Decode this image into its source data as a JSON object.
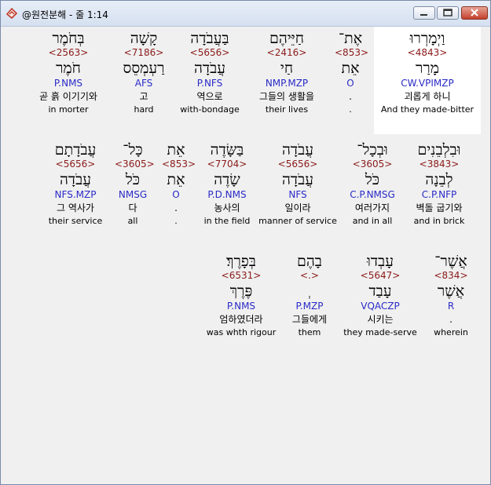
{
  "window": {
    "title": "@원전분해 - 줄 1:14"
  },
  "icons": {
    "app": "bible-app-icon",
    "minimize": "minimize-icon",
    "maximize": "maximize-icon",
    "close": "close-icon"
  },
  "rows": [
    {
      "words": [
        {
          "heb": "וַיְמָרְרוּ",
          "strong": "<4843>",
          "lemma": "מָרַר",
          "morph": "CW.VPIMZP",
          "kor": "괴롭게 하니",
          "eng": "And they made-bitter"
        },
        {
          "heb": "אֶת־",
          "strong": "<853>",
          "lemma": "אֵת",
          "morph": "O",
          "kor": ".",
          "eng": "."
        },
        {
          "heb": "חַיֵּיהֶם",
          "strong": "<2416>",
          "lemma": "חַי",
          "morph": "NMP.MZP",
          "kor": "그들의 생활을",
          "eng": "their lives"
        },
        {
          "heb": "בַּעֲבֹדָה",
          "strong": "<5656>",
          "lemma": "עֲבֹדָה",
          "morph": "P.NFS",
          "kor": "역으로",
          "eng": "with-bondage"
        },
        {
          "heb": "קָשָׁה",
          "strong": "<7186>",
          "lemma": "רַעְמְסֵס",
          "morph": "AFS",
          "kor": "고",
          "eng": "hard"
        },
        {
          "heb": "בְּחֹמֶר",
          "strong": "<2563>",
          "lemma": "חֹמֶר",
          "morph": "P.NMS",
          "kor": "곧 흙 이기기와",
          "eng": "in morter"
        }
      ]
    },
    {
      "words": [
        {
          "heb": "וּבִלְבֵנִים",
          "strong": "<3843>",
          "lemma": "לְבֵנָה",
          "morph": "C.P.NFP",
          "kor": "벽돌 굽기와",
          "eng": "and in brick"
        },
        {
          "heb": "וּבְכָל־",
          "strong": "<3605>",
          "lemma": "כֹּל",
          "morph": "C.P.NMSG",
          "kor": "여러가지",
          "eng": "and in all"
        },
        {
          "heb": "עֲבֹדָה",
          "strong": "<5656>",
          "lemma": "עֲבֹדָה",
          "morph": "NFS",
          "kor": "일이라",
          "eng": "manner of service"
        },
        {
          "heb": "בַּשָּׂדֶה",
          "strong": "<7704>",
          "lemma": "שָׂדֶה",
          "morph": "P.D.NMS",
          "kor": "농사의",
          "eng": "in the field"
        },
        {
          "heb": "אֵת",
          "strong": "<853>",
          "lemma": "אֵת",
          "morph": "O",
          "kor": ".",
          "eng": "."
        },
        {
          "heb": "כָּל־",
          "strong": "<3605>",
          "lemma": "כֹּל",
          "morph": "NMSG",
          "kor": "다",
          "eng": "all"
        },
        {
          "heb": "עֲבֹדָתָם",
          "strong": "<5656>",
          "lemma": "עֲבֹדָה",
          "morph": "NFS.MZP",
          "kor": "그 역사가",
          "eng": "their service"
        }
      ]
    },
    {
      "words": [
        {
          "heb": "אֲשֶׁר־",
          "strong": "<834>",
          "lemma": "אֲשֶׁר",
          "morph": "R",
          "kor": ".",
          "eng": "wherein"
        },
        {
          "heb": "עָבְדוּ",
          "strong": "<5647>",
          "lemma": "עָבַד",
          "morph": "VQACZP",
          "kor": "시키는",
          "eng": "they made-serve"
        },
        {
          "heb": "בָהֶם",
          "strong": "<.>",
          "lemma": "ְ",
          "morph": "P.MZP",
          "kor": "그들에게",
          "eng": "them"
        },
        {
          "heb": "בְּפָרֶךְ׃",
          "strong": "<6531>",
          "lemma": "פֶּרֶךְ",
          "morph": "P.NMS",
          "kor": "엄하였더라",
          "eng": "was whth rigour"
        }
      ]
    }
  ]
}
